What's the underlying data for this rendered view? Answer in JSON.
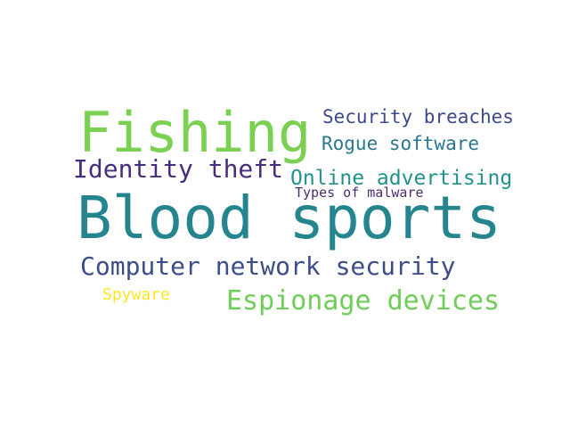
{
  "words": [
    {
      "text": "Fishing",
      "color": "#7ad151"
    },
    {
      "text": "Blood sports",
      "color": "#25858e"
    },
    {
      "text": "Identity theft",
      "color": "#472d7b"
    },
    {
      "text": "Security breaches",
      "color": "#3e4a89"
    },
    {
      "text": "Rogue software",
      "color": "#2a788e"
    },
    {
      "text": "Online advertising",
      "color": "#22928c"
    },
    {
      "text": "Types of malware",
      "color": "#4b2d70"
    },
    {
      "text": "Computer network security",
      "color": "#3d4d8a"
    },
    {
      "text": "Spyware",
      "color": "#fde725"
    },
    {
      "text": "Espionage devices",
      "color": "#6ece58"
    }
  ]
}
